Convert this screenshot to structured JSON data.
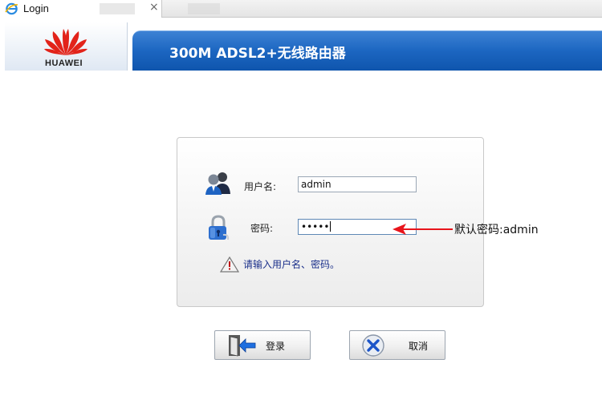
{
  "browser": {
    "tab_title": "Login",
    "close_glyph": "×"
  },
  "header": {
    "logo_text": "HUAWEI",
    "title": "300M ADSL2+无线路由器"
  },
  "login": {
    "username_label": "用户名:",
    "username_value": "admin",
    "password_label": "密码:",
    "password_value": "•••••",
    "hint": "请输入用户名、密码。"
  },
  "annotation": {
    "text": "默认密码:admin",
    "color": "#e8141b"
  },
  "buttons": {
    "login_label": "登录",
    "cancel_label": "取消"
  },
  "colors": {
    "title_bar": "#1c66c1",
    "logo_red": "#e2231a",
    "hint_text": "#1a2f8a"
  }
}
